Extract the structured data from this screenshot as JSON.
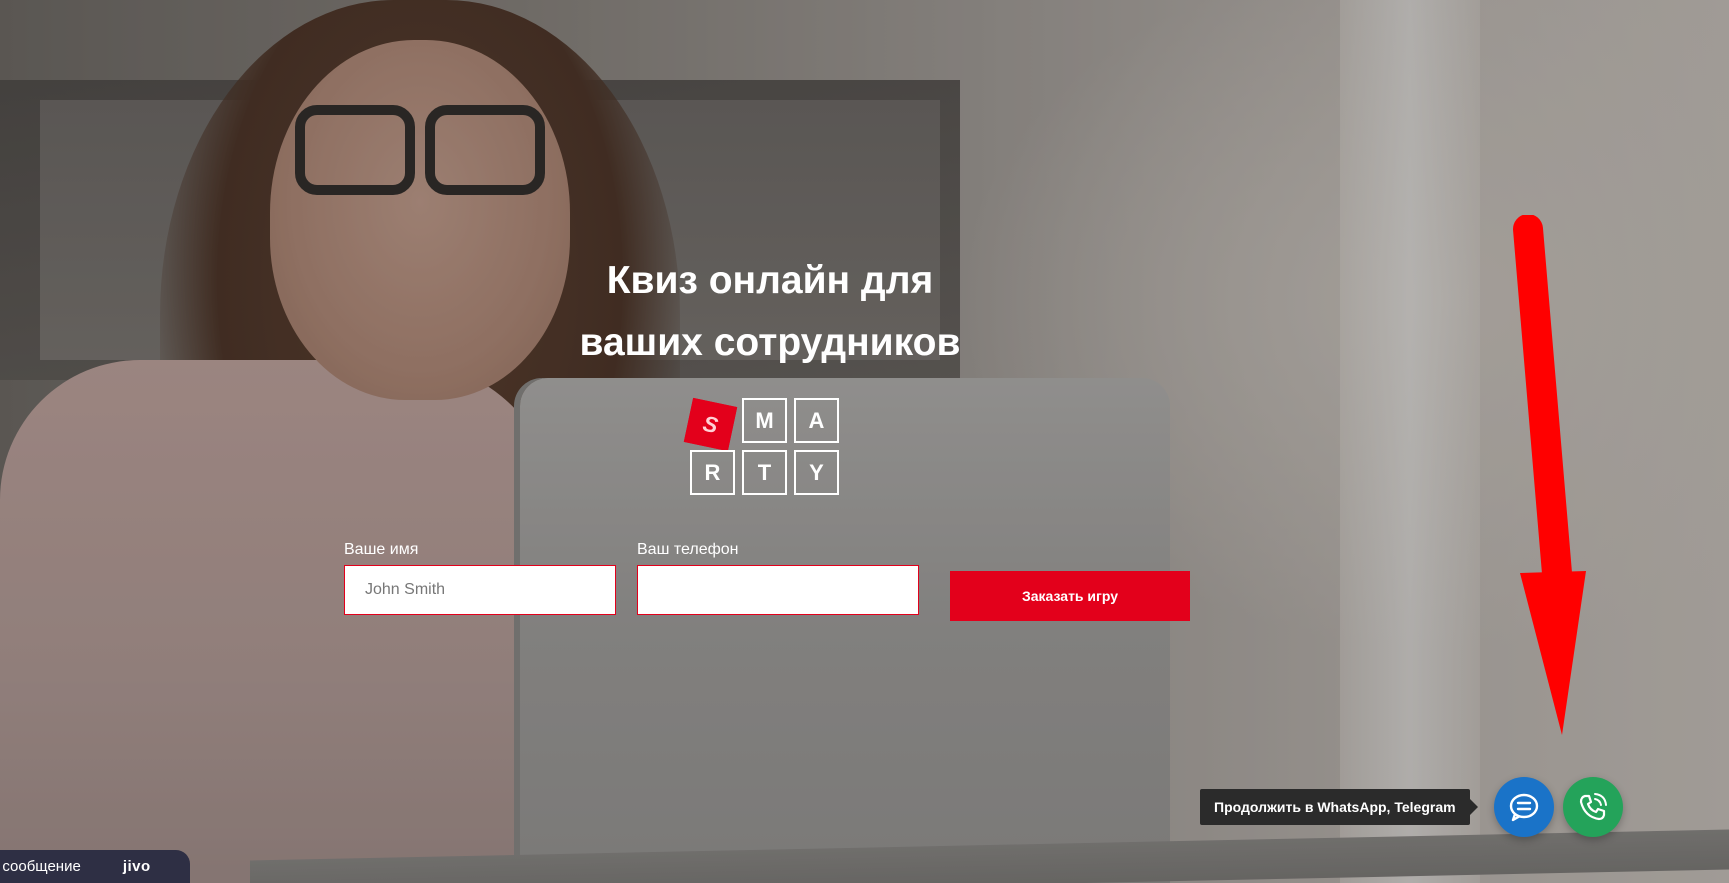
{
  "hero": {
    "title_line1": "Квиз онлайн для",
    "title_line2": "ваших сотрудников"
  },
  "logo": {
    "letters": [
      "S",
      "M",
      "A",
      "R",
      "T",
      "Y"
    ],
    "accent_color": "#e3001b"
  },
  "form": {
    "name_label": "Ваше имя",
    "name_placeholder": "John Smith",
    "name_value": "",
    "phone_label": "Ваш телефон",
    "phone_placeholder": "",
    "phone_value": "",
    "submit_label": "Заказать игру"
  },
  "widgets": {
    "tooltip_text": "Продолжить в WhatsApp, Telegram",
    "chat_icon": "chat-bubble-icon",
    "call_icon": "phone-call-icon",
    "chat_color": "#1a73c8",
    "call_color": "#24a35a"
  },
  "jivo": {
    "message_text": "ı сообщение",
    "brand": "jivo"
  },
  "annotation": {
    "arrow_color": "#ff0000",
    "arrow_icon": "down-arrow-icon"
  }
}
